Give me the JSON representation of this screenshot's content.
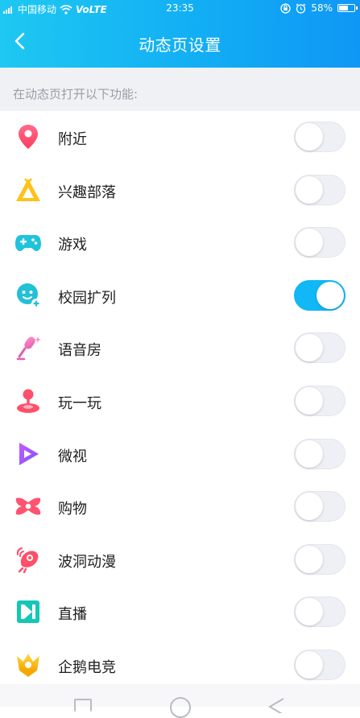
{
  "status_bar": {
    "carrier": "中国移动",
    "network": "VoLTE",
    "time": "23:35",
    "battery": "58%"
  },
  "header": {
    "title": "动态页设置",
    "back_icon": "chevron-left-icon"
  },
  "section": {
    "label": "在动态页打开以下功能:"
  },
  "items": [
    {
      "label": "附近",
      "icon": "location-pin-icon",
      "enabled": false
    },
    {
      "label": "兴趣部落",
      "icon": "tribe-triangle-icon",
      "enabled": false
    },
    {
      "label": "游戏",
      "icon": "gamepad-icon",
      "enabled": false
    },
    {
      "label": "校园扩列",
      "icon": "campus-bubble-icon",
      "enabled": true
    },
    {
      "label": "语音房",
      "icon": "microphone-icon",
      "enabled": false
    },
    {
      "label": "玩一玩",
      "icon": "joystick-icon",
      "enabled": false
    },
    {
      "label": "微视",
      "icon": "weishi-play-icon",
      "enabled": false
    },
    {
      "label": "购物",
      "icon": "shopping-bow-icon",
      "enabled": false
    },
    {
      "label": "波洞动漫",
      "icon": "bodong-comic-icon",
      "enabled": false
    },
    {
      "label": "直播",
      "icon": "live-n-icon",
      "enabled": false
    },
    {
      "label": "企鹅电竞",
      "icon": "esports-crown-icon",
      "enabled": false
    }
  ],
  "colors": {
    "header_start": "#1ec8f2",
    "header_end": "#0f97f5",
    "toggle_on": "#12b7f5",
    "toggle_off": "#eef0f5"
  }
}
